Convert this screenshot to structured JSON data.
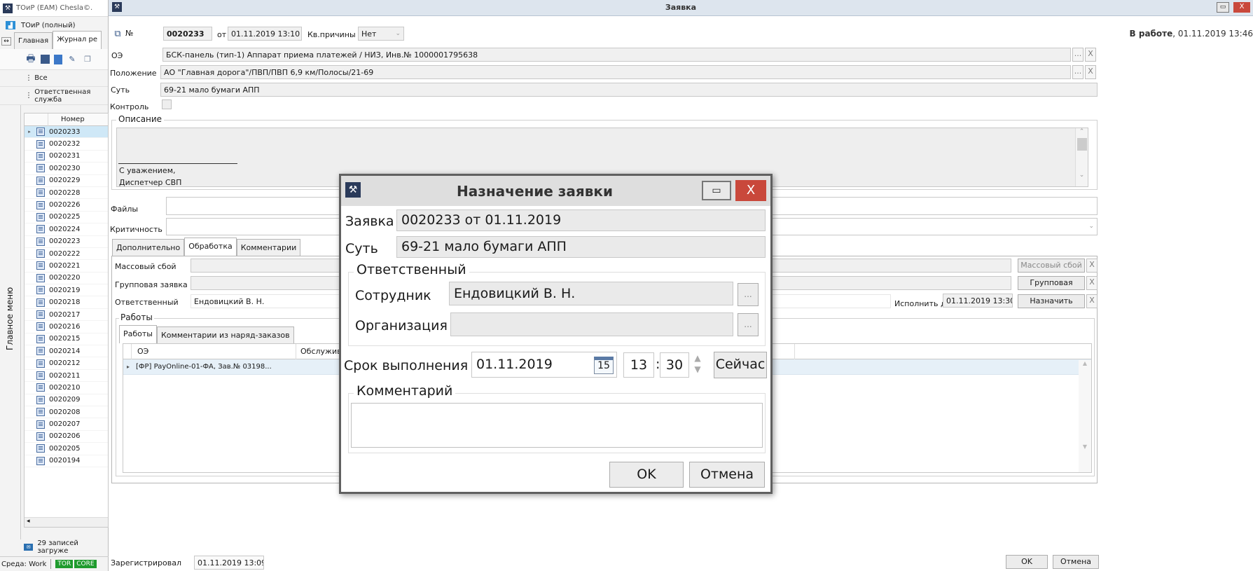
{
  "left_app": {
    "title": "ТОиР (EAM) Chesla©.",
    "subtitle": "ТОиР (полный)",
    "tabs": [
      "Главная",
      "Журнал ре"
    ],
    "filter_all": "Все",
    "filter_service": "Ответственная служба",
    "side_label": "Главное меню",
    "list_header": "Номер",
    "rows": [
      "0020233",
      "0020232",
      "0020231",
      "0020230",
      "0020229",
      "0020228",
      "0020226",
      "0020225",
      "0020224",
      "0020223",
      "0020222",
      "0020221",
      "0020220",
      "0020219",
      "0020218",
      "0020217",
      "0020216",
      "0020215",
      "0020214",
      "0020212",
      "0020211",
      "0020210",
      "0020209",
      "0020208",
      "0020207",
      "0020206",
      "0020205",
      "0020194"
    ],
    "status": "29 записей загруже",
    "env": "Среда: Work",
    "badges": [
      "TOR",
      "CORE"
    ]
  },
  "form": {
    "window_title": "Заявка",
    "num_label": "№",
    "num": "0020233",
    "from_label": "от",
    "date": "01.11.2019 13:10",
    "reason_label": "Кв.причины",
    "reason": "Нет",
    "status_bold": "В работе",
    "status_rest": ", 01.11.2019 13:46",
    "oe_label": "ОЭ",
    "oe": "БСК-панель (тип-1) Аппарат приема платежей / НИЗ, Инв.№ 1000001795638",
    "position_label": "Положение",
    "position": "АО \"Главная дорога\"/ПВП/ПВП 6,9 км/Полосы/21-69",
    "essence_label": "Суть",
    "essence": "69-21 мало бумаги АПП",
    "control_label": "Контроль",
    "description_label": "Описание",
    "desc_line1": "С уважением,",
    "desc_line2": "Диспетчер СВП",
    "files_label": "Файлы",
    "criticality_label": "Критичность",
    "tabs": [
      "Дополнительно",
      "Обработка",
      "Комментарии"
    ],
    "mass_label": "Массовый сбой",
    "group_label": "Групповая заявка",
    "resp_label": "Ответственный",
    "resp": "Ендовицкий В. Н.",
    "due_label": "Исполнить до",
    "due": "01.11.2019 13:30",
    "btn_mass": "Массовый сбой",
    "btn_group": "Групповая",
    "btn_assign": "Назначить",
    "works_label": "Работы",
    "work_tabs": [
      "Работы",
      "Комментарии из наряд-заказов"
    ],
    "grid_cols": [
      "ОЭ",
      "Обслужив"
    ],
    "grid_row": "[ФР] PayOnline-01-ФА, Зав.№ 03198...",
    "registered_label": "Зарегистрировал",
    "registered": "01.11.2019 13:09",
    "ok": "OK",
    "cancel": "Отмена",
    "dots": "...",
    "x": "X"
  },
  "dialog": {
    "title": "Назначение заявки",
    "request_label": "Заявка",
    "request": "0020233 от 01.11.2019",
    "essence_label": "Суть",
    "essence": "69-21 мало бумаги АПП",
    "group_label": "Ответственный",
    "employee_label": "Сотрудник",
    "employee": "Ендовицкий В. Н.",
    "org_label": "Организация",
    "org": "",
    "deadline_label": "Срок выполнения",
    "deadline_date": "01.11.2019",
    "cal_day": "15",
    "hour": "13",
    "minute": "30",
    "now_btn": "Сейчас",
    "comment_label": "Комментарий",
    "ok": "OK",
    "cancel": "Отмена",
    "dots": "..."
  },
  "colors": {
    "accent_red": "#c9483b",
    "green_badge": "#1f9b2e",
    "row_select": "#cfe8f7"
  }
}
